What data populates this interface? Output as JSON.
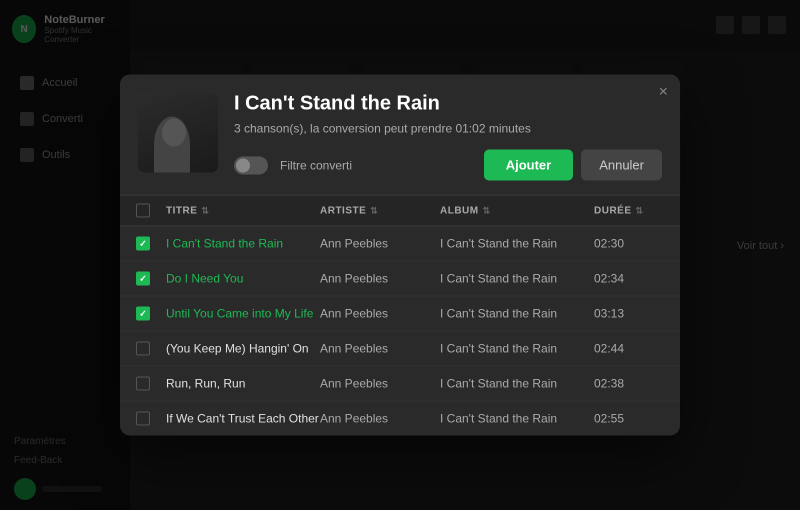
{
  "app": {
    "title": "NoteBurner",
    "subtitle": "Spotify Music Converter"
  },
  "sidebar": {
    "nav_items": [
      {
        "id": "accueil",
        "label": "Accueil",
        "active": false
      },
      {
        "id": "converti",
        "label": "Converti",
        "active": false
      },
      {
        "id": "outils",
        "label": "Outils",
        "active": false
      }
    ],
    "bottom_links": [
      {
        "id": "parametres",
        "label": "Paramètres"
      },
      {
        "id": "feedback",
        "label": "Feed-Back"
      }
    ]
  },
  "modal": {
    "close_label": "×",
    "title": "I Can't Stand the Rain",
    "subtitle": "3 chanson(s), la conversion peut prendre 01:02 minutes",
    "filter_label": "Filtre converti",
    "btn_add": "Ajouter",
    "btn_cancel": "Annuler",
    "table": {
      "headers": [
        {
          "id": "check",
          "label": ""
        },
        {
          "id": "titre",
          "label": "TITRE"
        },
        {
          "id": "artiste",
          "label": "ARTISTE"
        },
        {
          "id": "album",
          "label": "ALBUM"
        },
        {
          "id": "duree",
          "label": "DURÉE"
        }
      ],
      "rows": [
        {
          "checked": true,
          "title": "I Can't Stand the Rain",
          "artist": "Ann Peebles",
          "album": "I Can't Stand the Rain",
          "duration": "02:30"
        },
        {
          "checked": true,
          "title": "Do I Need You",
          "artist": "Ann Peebles",
          "album": "I Can't Stand the Rain",
          "duration": "02:34"
        },
        {
          "checked": true,
          "title": "Until You Came into My Life",
          "artist": "Ann Peebles",
          "album": "I Can't Stand the Rain",
          "duration": "03:13"
        },
        {
          "checked": false,
          "title": "(You Keep Me) Hangin' On",
          "artist": "Ann Peebles",
          "album": "I Can't Stand the Rain",
          "duration": "02:44"
        },
        {
          "checked": false,
          "title": "Run, Run, Run",
          "artist": "Ann Peebles",
          "album": "I Can't Stand the Rain",
          "duration": "02:38"
        },
        {
          "checked": false,
          "title": "If We Can't Trust Each Other",
          "artist": "Ann Peebles",
          "album": "I Can't Stand the Rain",
          "duration": "02:55"
        }
      ]
    }
  },
  "voir_tout": "Voir tout ›"
}
